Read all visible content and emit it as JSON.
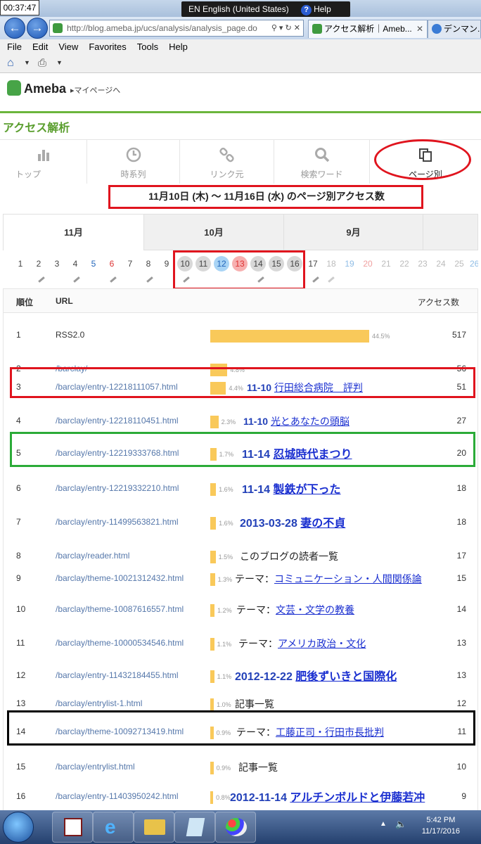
{
  "browser": {
    "clock": "00:37:47",
    "language_bar": "EN English (United States)",
    "help_label": "Help",
    "address": "http://blog.ameba.jp/ucs/analysis/analysis_page.do",
    "tabs": [
      "アクセス解析｜Ameb...",
      "デンマン..."
    ],
    "menu": [
      "File",
      "Edit",
      "View",
      "Favorites",
      "Tools",
      "Help"
    ]
  },
  "header": {
    "logo": "Ameba",
    "mypage_link": "マイページへ"
  },
  "section_title": "アクセス解析",
  "top_tabs": [
    "トップ",
    "時系列",
    "リンク元",
    "検索ワード",
    "ページ別"
  ],
  "active_top_tab": "ページ別",
  "date_range": "11月10日 (木) 〜 11月16日 (水) のページ別アクセス数",
  "month_tabs": [
    "11月",
    "10月",
    "9月"
  ],
  "days": [
    "1",
    "2",
    "3",
    "4",
    "5",
    "6",
    "7",
    "8",
    "9",
    "10",
    "11",
    "12",
    "13",
    "14",
    "15",
    "16",
    "17",
    "18",
    "19",
    "20",
    "21",
    "22",
    "23",
    "24",
    "25",
    "26"
  ],
  "selected_days": [
    "10",
    "11",
    "12",
    "13",
    "14",
    "15",
    "16"
  ],
  "table": {
    "headers": {
      "rank": "順位",
      "url": "URL",
      "count": "アクセス数"
    },
    "rows": [
      {
        "rank": "1",
        "url": "RSS2.0",
        "pct": "44.5%",
        "pct_value": 44.5,
        "count": "517",
        "ann_date": "",
        "ann_text": "",
        "ann_link": ""
      },
      {
        "rank": "2",
        "url": "/barclay/",
        "pct": "4.8%",
        "pct_value": 4.8,
        "count": "56",
        "ann_date": "",
        "ann_text": "",
        "ann_link": ""
      },
      {
        "rank": "3",
        "url": "/barclay/entry-12218111057.html",
        "pct": "4.4%",
        "pct_value": 4.4,
        "count": "51",
        "ann_date": "11-10",
        "ann_text": "",
        "ann_link": "行田総合病院　評判"
      },
      {
        "rank": "4",
        "url": "/barclay/entry-12218110451.html",
        "pct": "2.3%",
        "pct_value": 2.3,
        "count": "27",
        "ann_date": "11-10",
        "ann_text": "",
        "ann_link": "光とあなたの頭脳"
      },
      {
        "rank": "5",
        "url": "/barclay/entry-12219333768.html",
        "pct": "1.7%",
        "pct_value": 1.7,
        "count": "20",
        "ann_date": "11-14",
        "ann_text": "",
        "ann_link": "忍城時代まつり"
      },
      {
        "rank": "6",
        "url": "/barclay/entry-12219332210.html",
        "pct": "1.6%",
        "pct_value": 1.6,
        "count": "18",
        "ann_date": "11-14",
        "ann_text": "",
        "ann_link": "製鉄が下った"
      },
      {
        "rank": "7",
        "url": "/barclay/entry-11499563821.html",
        "pct": "1.6%",
        "pct_value": 1.6,
        "count": "18",
        "ann_date": "2013-03-28",
        "ann_text": "",
        "ann_link": "妻の不貞"
      },
      {
        "rank": "8",
        "url": "/barclay/reader.html",
        "pct": "1.5%",
        "pct_value": 1.5,
        "count": "17",
        "ann_date": "",
        "ann_text": "このブログの読者一覧",
        "ann_link": ""
      },
      {
        "rank": "9",
        "url": "/barclay/theme-10021312432.html",
        "pct": "1.3%",
        "pct_value": 1.3,
        "count": "15",
        "ann_date": "",
        "ann_text": "テーマ：",
        "ann_link": "コミュニケーション・人間関係論"
      },
      {
        "rank": "10",
        "url": "/barclay/theme-10087616557.html",
        "pct": "1.2%",
        "pct_value": 1.2,
        "count": "14",
        "ann_date": "",
        "ann_text": "テーマ：",
        "ann_link": "文芸・文学の教養"
      },
      {
        "rank": "11",
        "url": "/barclay/theme-10000534546.html",
        "pct": "1.1%",
        "pct_value": 1.1,
        "count": "13",
        "ann_date": "",
        "ann_text": "テーマ：",
        "ann_link": "アメリカ政治・文化"
      },
      {
        "rank": "12",
        "url": "/barclay/entry-11432184455.html",
        "pct": "1.1%",
        "pct_value": 1.1,
        "count": "13",
        "ann_date": "2012-12-22",
        "ann_text": "",
        "ann_link": "肥後ずいきと国際化"
      },
      {
        "rank": "13",
        "url": "/barclay/entrylist-1.html",
        "pct": "1.0%",
        "pct_value": 1.0,
        "count": "12",
        "ann_date": "",
        "ann_text": "記事一覧",
        "ann_link": ""
      },
      {
        "rank": "14",
        "url": "/barclay/theme-10092713419.html",
        "pct": "0.9%",
        "pct_value": 0.9,
        "count": "11",
        "ann_date": "",
        "ann_text": "テーマ：",
        "ann_link": "工藤正司・行田市長批判"
      },
      {
        "rank": "15",
        "url": "/barclay/entrylist.html",
        "pct": "0.9%",
        "pct_value": 0.9,
        "count": "10",
        "ann_date": "",
        "ann_text": "記事一覧",
        "ann_link": ""
      },
      {
        "rank": "16",
        "url": "/barclay/entry-11403950242.html",
        "pct": "0.8%",
        "pct_value": 0.8,
        "count": "9",
        "ann_date": "2012-11-14",
        "ann_text": "",
        "ann_link": "アルチンボルドと伊藤若冲"
      }
    ]
  },
  "taskbar": {
    "time": "5:42 PM",
    "date": "11/17/2016"
  },
  "colors": {
    "accent_green": "#5a9e2e",
    "bar": "#f9c95a",
    "box_red": "#e0141e",
    "box_green": "#2bab38",
    "box_black": "#000000"
  }
}
